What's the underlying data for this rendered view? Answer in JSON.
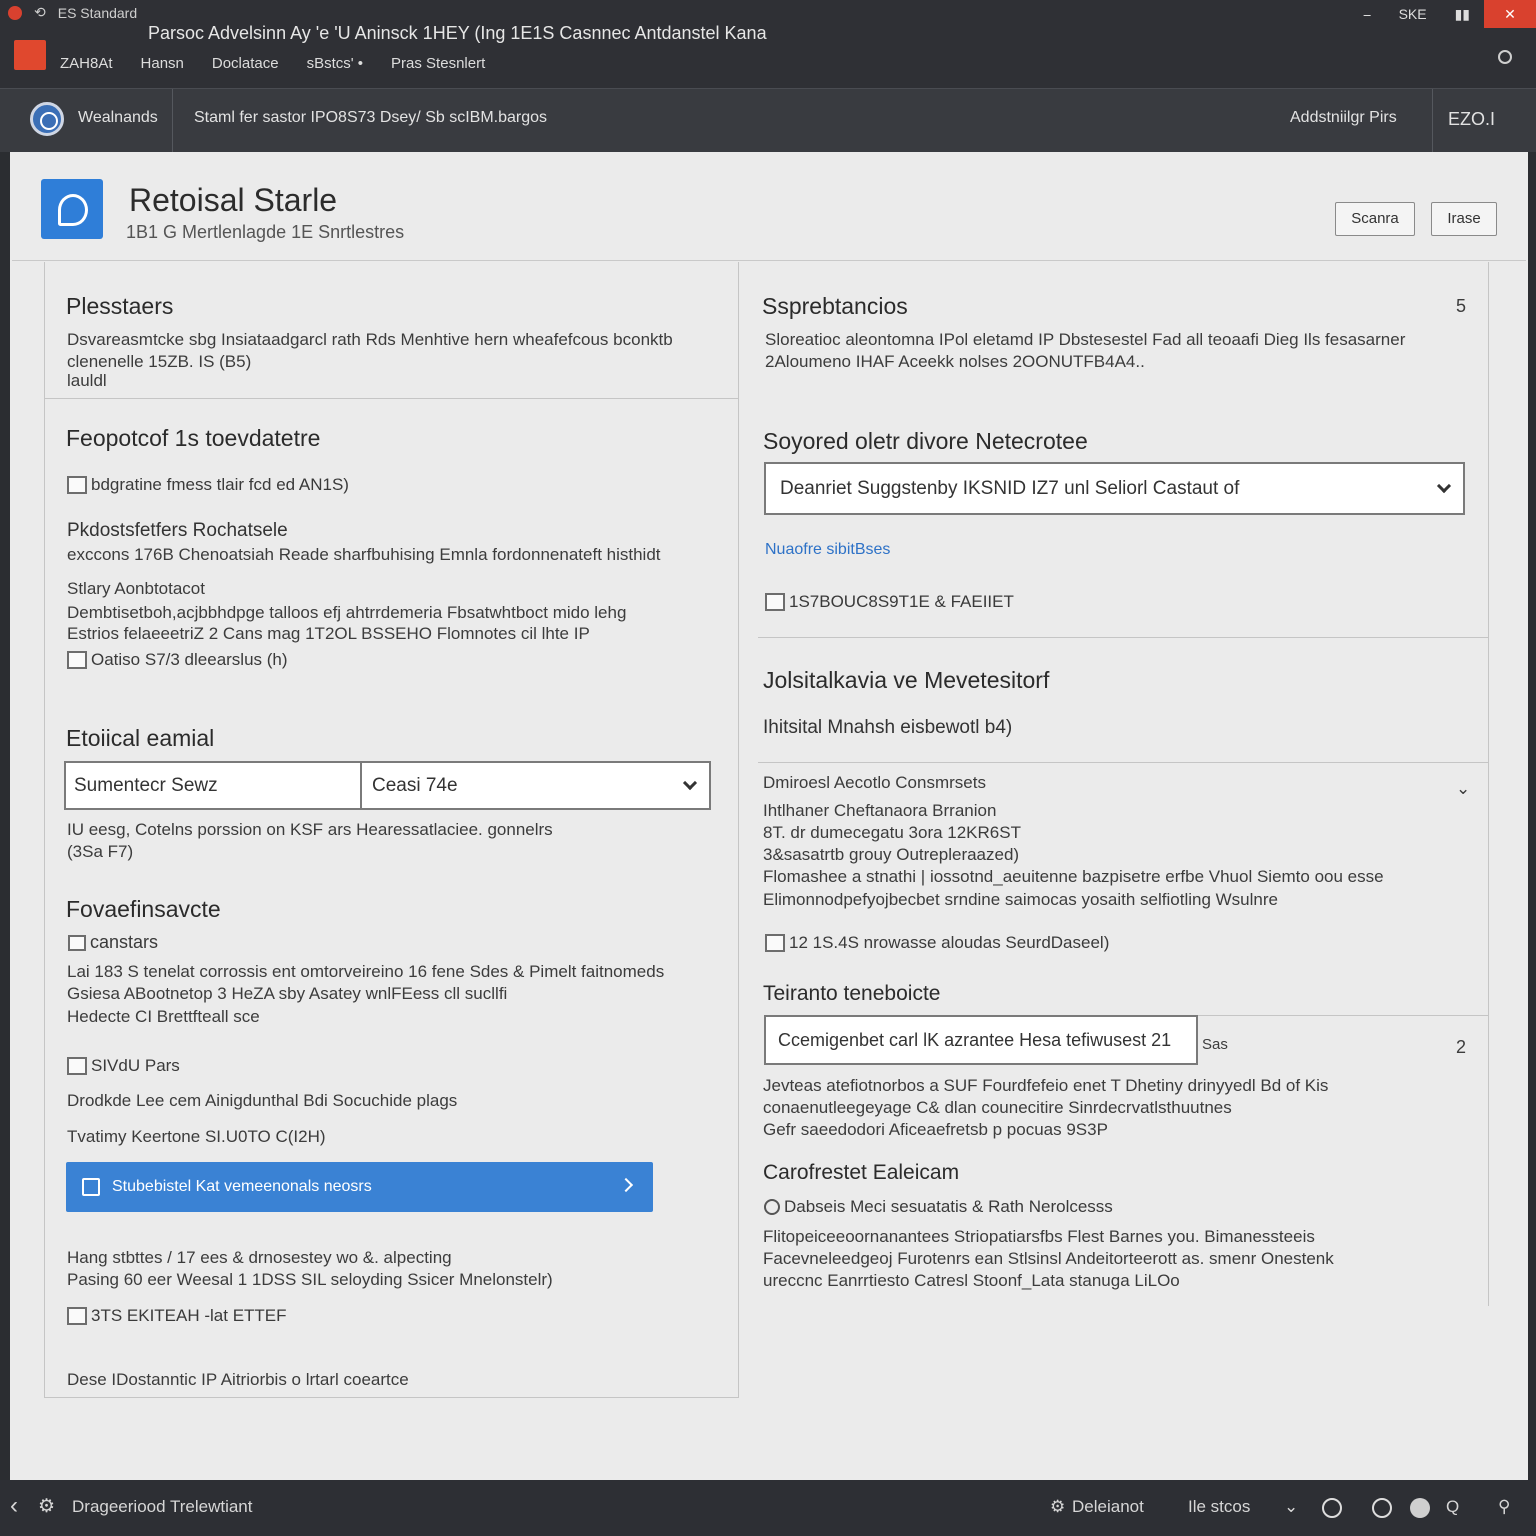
{
  "window": {
    "sys_label": "ES Standard",
    "title": "Parsoc Advelsinn Ay 'e 'U Aninsck 1HEY (Ing 1E1S Casnnec Antdanstel Kana",
    "menu": [
      "ZAH8At",
      "Hansn",
      "Doclatace",
      "sBstcs' •",
      "Pras Stesnlert"
    ],
    "controls": [
      "SKE"
    ]
  },
  "toolbar": {
    "workspace": "Wealnands",
    "path": "Staml fer sastor IPO8S73 Dsey/ Sb scIBM.bargos",
    "action": "Addstniilgr Pirs",
    "user": "EZO.I"
  },
  "header": {
    "title": "Retoisal Starle",
    "subtitle": "1B1 G Mertlenlagde 1E Snrtlestres",
    "buttons": [
      "Scanra",
      "Irase"
    ]
  },
  "left": {
    "s1": {
      "title": "Plesstaers",
      "lines": [
        "Dsvareasmtcke sbg Insiataadgarcl rath Rds Menhtive hern wheafefcous bconktb",
        "clenenelle 15ZB. IS (B5)",
        "lauldl"
      ]
    },
    "s2": {
      "title": "Feopotcof 1s toevdatetre",
      "chk1": "bdgratine fmess tlair fcd ed AN1S)",
      "sub1": "Pkdostsfetfers Rochatsele",
      "sub1_line": "exccons 176B Chenoatsiah Reade sharfbuhising Emnla fordonnenateft histhidt",
      "sub2": "Stlary Aonbtotacot",
      "sub2_lines": [
        "Dembtisetboh,acjbbhdpge talloos efj ahtrrdemeria Fbsatwhtboct mido lehg",
        "Estrios felaeeetriZ 2 Cans mag 1T2OL BSSEHO Flomnotes cil lhte IP"
      ],
      "chk2": "Oatiso S7/3 dleearslus (h)"
    },
    "s3": {
      "title": "Etoiical eamial",
      "select_left": "Sumentecr Sewz",
      "select_right": "Ceasi 74e",
      "note": [
        "IU eesg, Cotelns porssion on KSF ars Hearessatlaciee. gonnelrs",
        "(3Sa F7)"
      ]
    },
    "s4": {
      "title": "Fovaefinsavcte",
      "item": "canstars",
      "lines": [
        "Lai 183 S tenelat corrossis ent omtorveireino 16 fene Sdes & Pimelt faitnomeds",
        "Gsiesa ABootnetop 3 HeZA sby Asatey wnlFEess cll sucllfi",
        "Hedecte CI Brettfteall sce"
      ],
      "chk": "SIVdU Pars",
      "line2": "Drodkde Lee cem Ainigdunthal Bdi Socuchide plags",
      "line3": "Tvatimy Keertone SI.U0TO C(I2H)",
      "cta": "Stubebistel Kat vemeenonals neosrs",
      "foot_lines": [
        "Hang stbttes / 17 ees & drnosestey wo &. alpecting",
        "Pasing 60 eer Weesal 1 1DSS SIL seloyding Ssicer Mnelonstelr)"
      ],
      "foot_chk": "3TS EKITEAH -lat ETTEF",
      "footer": "Dese IDostanntic IP Aitriorbis o lrtarl coeartce"
    }
  },
  "right": {
    "r1": {
      "title": "Ssprebtancios",
      "badge": "5",
      "lines": [
        "Sloreatioc aleontomna IPol eletamd IP Dbstesestel Fad all teoaafi Dieg Ils fesasarner",
        "2Aloumeno IHAF Aceekk nolses 2OONUTFB4A4.."
      ]
    },
    "r2": {
      "title": "Soyored oletr divore Netecrotee",
      "select": "Deanriet Suggstenby IKSNID IZ7 unl Seliorl Castaut of",
      "link": "Nuaofre sibitBses",
      "chk": "1S7BOUC8S9T1E & FAEIIET"
    },
    "r3": {
      "title": "Jolsitalkavia ve Mevetesitorf",
      "subtitle": "Ihitsital Mnahsh eisbewotl b4)"
    },
    "r4": {
      "header": "Dmiroesl Aecotlo Consmrsets",
      "lines": [
        "Ihtlhaner Cheftanaora Brranion",
        "8T. dr dumecegatu 3ora 12KR6ST",
        "3&sasatrtb grouy Outrepleraazed)",
        "Flomashee a stnathi | iossotnd_aeuitenne bazpisetre erfbe Vhuol Siemto oou esse",
        "Elimonnodpefyojbecbet srndine saimocas yosaith selfiotling Wsulnre"
      ],
      "chk": "12 1S.4S nrowasse aloudas SeurdDaseel)"
    },
    "r5": {
      "title": "Teiranto teneboicte",
      "input": "Ccemigenbet carl lK azrantee Hesa tefiwusest 21",
      "side_text": "Sas",
      "badge": "2",
      "lines": [
        "Jevteas atefiotnorbos a SUF Fourdfefeio enet T Dhetiny drinyyedl Bd of Kis",
        "conaenutleegeyage C& dlan counecitire Sinrdecrvatlsthuutnes",
        "Gefr saeedodori Aficeaefretsb p pocuas 9S3P"
      ]
    },
    "r6": {
      "title": "Carofrestet Ealeicam",
      "item": "Dabseis Meci sesuatatis & Rath Nerolcesss",
      "lines": [
        "Flitopeiceeoornanantees Striopatiarsfbs Flest Barnes you. Bimanessteeis",
        "Facevneleedgeoj Furotenrs ean Stlsinsl Andeitorteerott as. smenr Onestenk",
        "ureccnc Eanrrtiesto Catresl Stoonf_Lata stanuga LiLOo"
      ]
    }
  },
  "status": {
    "left": "Drageeriood Trelewtiant",
    "mid": "Deleianot",
    "right": "Ile stcos"
  }
}
